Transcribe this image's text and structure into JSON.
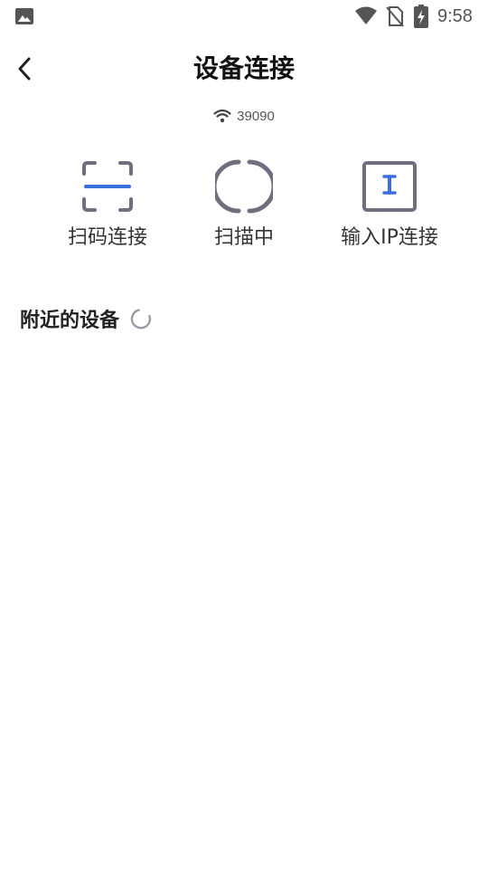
{
  "status_bar": {
    "time": "9:58",
    "icons": [
      "gallery-icon",
      "wifi-icon",
      "no-sim-icon",
      "battery-charging-icon"
    ]
  },
  "header": {
    "title": "设备连接",
    "back_icon": "chevron-left-icon"
  },
  "network": {
    "icon": "wifi-icon",
    "name": "39090"
  },
  "actions": [
    {
      "label": "扫码连接",
      "icon": "scan-qr-icon"
    },
    {
      "label": "扫描中",
      "icon": "loading-ring-icon"
    },
    {
      "label": "输入IP连接",
      "icon": "text-input-icon"
    }
  ],
  "nearby": {
    "title": "附近的设备",
    "icon": "spinner-icon"
  },
  "colors": {
    "accent": "#3b6fe0",
    "icon_gray": "#6f6f80",
    "text": "#222222"
  }
}
